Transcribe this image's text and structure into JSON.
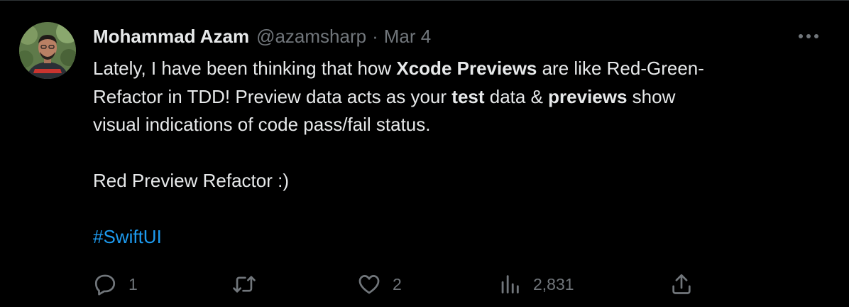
{
  "tweet": {
    "author": {
      "display_name": "Mohammad Azam",
      "handle": "@azamsharp"
    },
    "separator": "·",
    "date": "Mar 4",
    "body": {
      "line1": {
        "pre": "Lately, I have been thinking that how ",
        "bold": "Xcode Previews",
        "post": " are like Red-Green-"
      },
      "line2": {
        "pre": "Refactor in TDD! Preview data acts as your ",
        "bold1": "test",
        "mid": " data & ",
        "bold2": "previews",
        "post": " show"
      },
      "line3": "visual indications of code pass/fail status.",
      "line4": "Red Preview Refactor :)",
      "hashtag": "#SwiftUI"
    },
    "actions": {
      "reply": {
        "icon": "reply-icon",
        "count": "1"
      },
      "retweet": {
        "icon": "retweet-icon",
        "count": ""
      },
      "like": {
        "icon": "heart-icon",
        "count": "2"
      },
      "views": {
        "icon": "views-icon",
        "count": "2,831"
      },
      "share": {
        "icon": "share-icon"
      }
    }
  },
  "colors": {
    "background": "#000000",
    "text": "#e7e9ea",
    "muted": "#71767b",
    "link": "#1d9bf0",
    "border": "#2f3336"
  }
}
